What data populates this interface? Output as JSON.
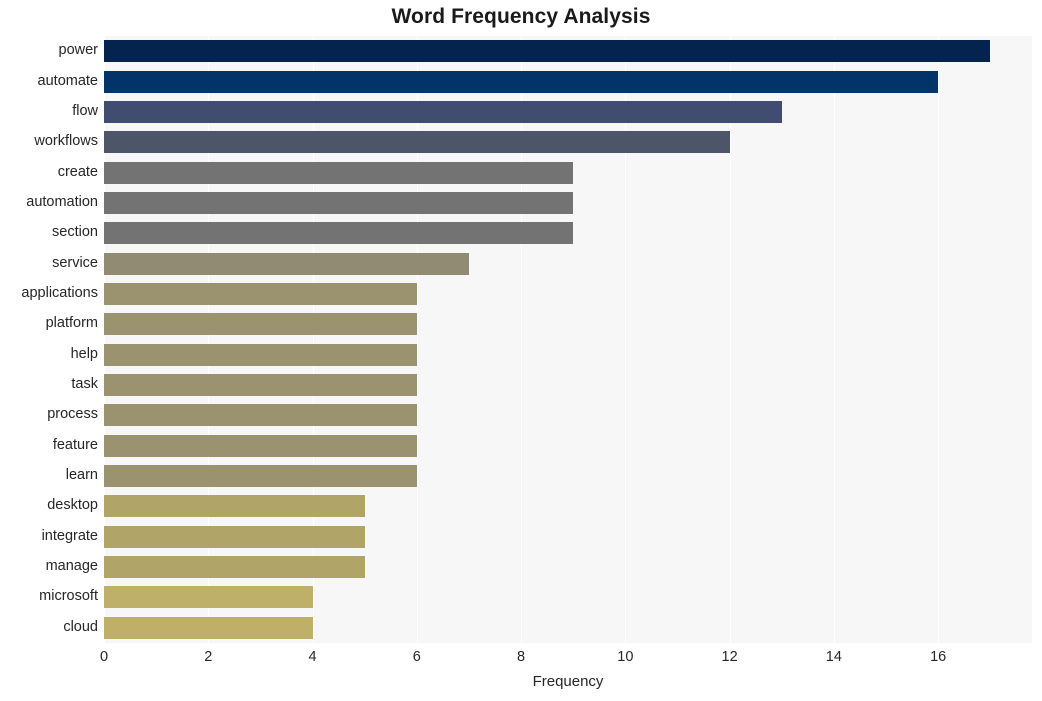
{
  "chart_data": {
    "type": "bar",
    "orientation": "horizontal",
    "title": "Word Frequency Analysis",
    "xlabel": "Frequency",
    "ylabel": "",
    "xlim": [
      0,
      17.8
    ],
    "xticks": [
      0,
      2,
      4,
      6,
      8,
      10,
      12,
      14,
      16
    ],
    "grid": "vertical",
    "legend": "none",
    "categories": [
      "power",
      "automate",
      "flow",
      "workflows",
      "create",
      "automation",
      "section",
      "service",
      "applications",
      "platform",
      "help",
      "task",
      "process",
      "feature",
      "learn",
      "desktop",
      "integrate",
      "manage",
      "microsoft",
      "cloud"
    ],
    "values": [
      17,
      16,
      13,
      12,
      9,
      9,
      9,
      7,
      6,
      6,
      6,
      6,
      6,
      6,
      6,
      5,
      5,
      5,
      4,
      4
    ],
    "bar_colors": [
      "#04234d",
      "#033469",
      "#414d70",
      "#4d5569",
      "#737373",
      "#737373",
      "#737373",
      "#918b74",
      "#9b9270",
      "#9b9270",
      "#9b9270",
      "#9b9270",
      "#9b9270",
      "#9b9270",
      "#9b9270",
      "#b0a468",
      "#b0a468",
      "#b0a468",
      "#bfb069",
      "#bfb069"
    ]
  },
  "style": {
    "plot_background": "#f7f7f7",
    "figure_background": "#ffffff",
    "gridline_color": "#ffffff",
    "text_color": "#262626"
  }
}
